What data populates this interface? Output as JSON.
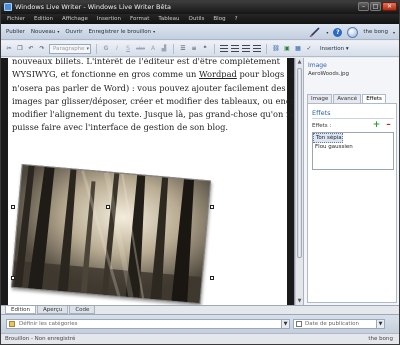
{
  "window": {
    "title": "Windows Live Writer - Windows Live Writer Bêta",
    "minimize": "–",
    "maximize": "□",
    "close": "✕"
  },
  "menu": [
    "Fichier",
    "Edition",
    "Affichage",
    "Insertion",
    "Format",
    "Tableau",
    "Outils",
    "Blog",
    "?"
  ],
  "toolbar": {
    "publish": "Publier",
    "new": "Nouveau",
    "open": "Ouvrir",
    "save_draft": "Enregistrer le brouillon",
    "blog_name": "the bong",
    "help": "?"
  },
  "format_bar": {
    "style_value": "Paragraphe",
    "bold": "G",
    "italic": "I",
    "underline": "S",
    "strike": "abc",
    "insert_label": "Insertion"
  },
  "editor": {
    "line1": "nouveaux billets. L'intérêt de l'éditeur est d'être complètement",
    "line2_a": "WYSIWYG, et fonctionne en gros comme un ",
    "line2_link": "Wordpad",
    "line2_b": " pour blogs (on",
    "line3": "n'osera pas parler de Word) : vous pouvez ajouter facilement des",
    "line4": "images par glisser/déposer, créer et modifier des tableaux, ou encore",
    "line5": "modifier l'alignement du texte. Jusque là, pas grand-chose qu'on ne",
    "line6": "puisse faire avec l'interface de gestion de son blog."
  },
  "sidebar": {
    "section_title": "Image",
    "file_name": "AeroWoods.jpg",
    "tabs": [
      "Image",
      "Avancé",
      "Effets"
    ],
    "effects_title": "Effets",
    "effects_label": "Effets :",
    "add": "+",
    "remove": "–",
    "effects_list": [
      "Ton sépia",
      "Flou gaussien"
    ]
  },
  "view_tabs": [
    "Edition",
    "Aperçu",
    "Code"
  ],
  "bottom": {
    "categories_placeholder": "Définir les catégories",
    "date_placeholder": "Date de publication"
  },
  "status": {
    "left": "Brouillon - Non enregistré",
    "right": "the bong"
  }
}
